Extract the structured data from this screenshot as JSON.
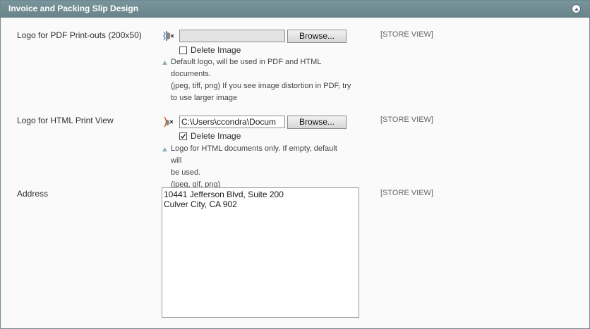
{
  "section": {
    "title": "Invoice and Packing Slip Design"
  },
  "fields": [
    {
      "label": "Logo for PDF Print-outs (200x50)",
      "file_value": "",
      "browse_label": "Browse...",
      "delete_label": "Delete Image",
      "delete_checked": false,
      "notes": [
        "Default logo, will be used in PDF and HTML",
        "documents.",
        "(jpeg, tiff, png) If you see image distortion in PDF, try",
        "to use larger image"
      ],
      "scope": "[STORE VIEW]"
    },
    {
      "label": "Logo for HTML Print View",
      "file_value": "C:\\Users\\ccondra\\Docum",
      "browse_label": "Browse...",
      "delete_label": "Delete Image",
      "delete_checked": true,
      "notes": [
        "Logo for HTML documents only. If empty, default will",
        "be used.",
        "(jpeg, gif, png)"
      ],
      "scope": "[STORE VIEW]"
    },
    {
      "label": "Address",
      "lines": [
        "10441 Jefferson Blvd, Suite 200",
        "Culver City, CA 902"
      ],
      "scope": "[STORE VIEW]"
    }
  ],
  "icons": {
    "collapse": "collapse-up-icon",
    "file_image_1": "image-thumbnail-icon",
    "file_image_2": "image-thumbnail-icon",
    "note": "note-triangle-icon",
    "check": "check-icon"
  },
  "colors": {
    "header": "#6f8992",
    "header_text": "#ffffff",
    "note_triangle": "#8fb0bd"
  }
}
